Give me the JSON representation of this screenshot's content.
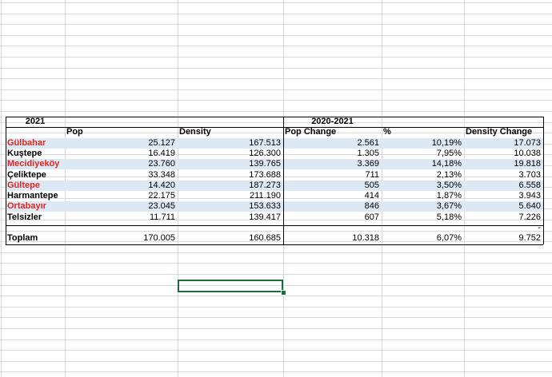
{
  "sheet": {
    "header": {
      "year_label": "2021",
      "period_label": "2020-2021",
      "columns": {
        "pop": "Pop",
        "density": "Density",
        "pop_change": "Pop Change",
        "percent": "%",
        "density_change": "Density Change"
      }
    },
    "rows": [
      {
        "name": "Gülbahar",
        "pop": "25.127",
        "density": "167.513",
        "pop_change": "2.561",
        "percent": "10,19%",
        "density_change": "17.073",
        "highlight": true,
        "shaded": true
      },
      {
        "name": "Kuştepe",
        "pop": "16.419",
        "density": "126.300",
        "pop_change": "1.305",
        "percent": "7,95%",
        "density_change": "10.038",
        "highlight": false,
        "shaded": false
      },
      {
        "name": "Mecidiyeköy",
        "pop": "23.760",
        "density": "139.765",
        "pop_change": "3.369",
        "percent": "14,18%",
        "density_change": "19.818",
        "highlight": true,
        "shaded": true
      },
      {
        "name": "Çeliktepe",
        "pop": "33.348",
        "density": "173.688",
        "pop_change": "711",
        "percent": "2,13%",
        "density_change": "3.703",
        "highlight": false,
        "shaded": false
      },
      {
        "name": "Gültepe",
        "pop": "14.420",
        "density": "187.273",
        "pop_change": "505",
        "percent": "3,50%",
        "density_change": "6.558",
        "highlight": true,
        "shaded": true
      },
      {
        "name": "Harmantepe",
        "pop": "22.175",
        "density": "211.190",
        "pop_change": "414",
        "percent": "1,87%",
        "density_change": "3.943",
        "highlight": false,
        "shaded": false
      },
      {
        "name": "Ortabayır",
        "pop": "23.045",
        "density": "153.633",
        "pop_change": "846",
        "percent": "3,67%",
        "density_change": "5.640",
        "highlight": true,
        "shaded": true
      },
      {
        "name": "Telsizler",
        "pop": "11.711",
        "density": "139.417",
        "pop_change": "607",
        "percent": "5,18%",
        "density_change": "7.226",
        "highlight": false,
        "shaded": false
      }
    ],
    "spacer_dash": "-",
    "total": {
      "label": "Toplam",
      "pop": "170.005",
      "density": "160.685",
      "pop_change": "10.318",
      "percent": "6,07%",
      "density_change": "9.752"
    }
  },
  "colors": {
    "highlight_text": "#e0251b",
    "band_fill": "#dde8f5",
    "gridline": "#d9d9d9",
    "selection": "#1f6b3a"
  }
}
